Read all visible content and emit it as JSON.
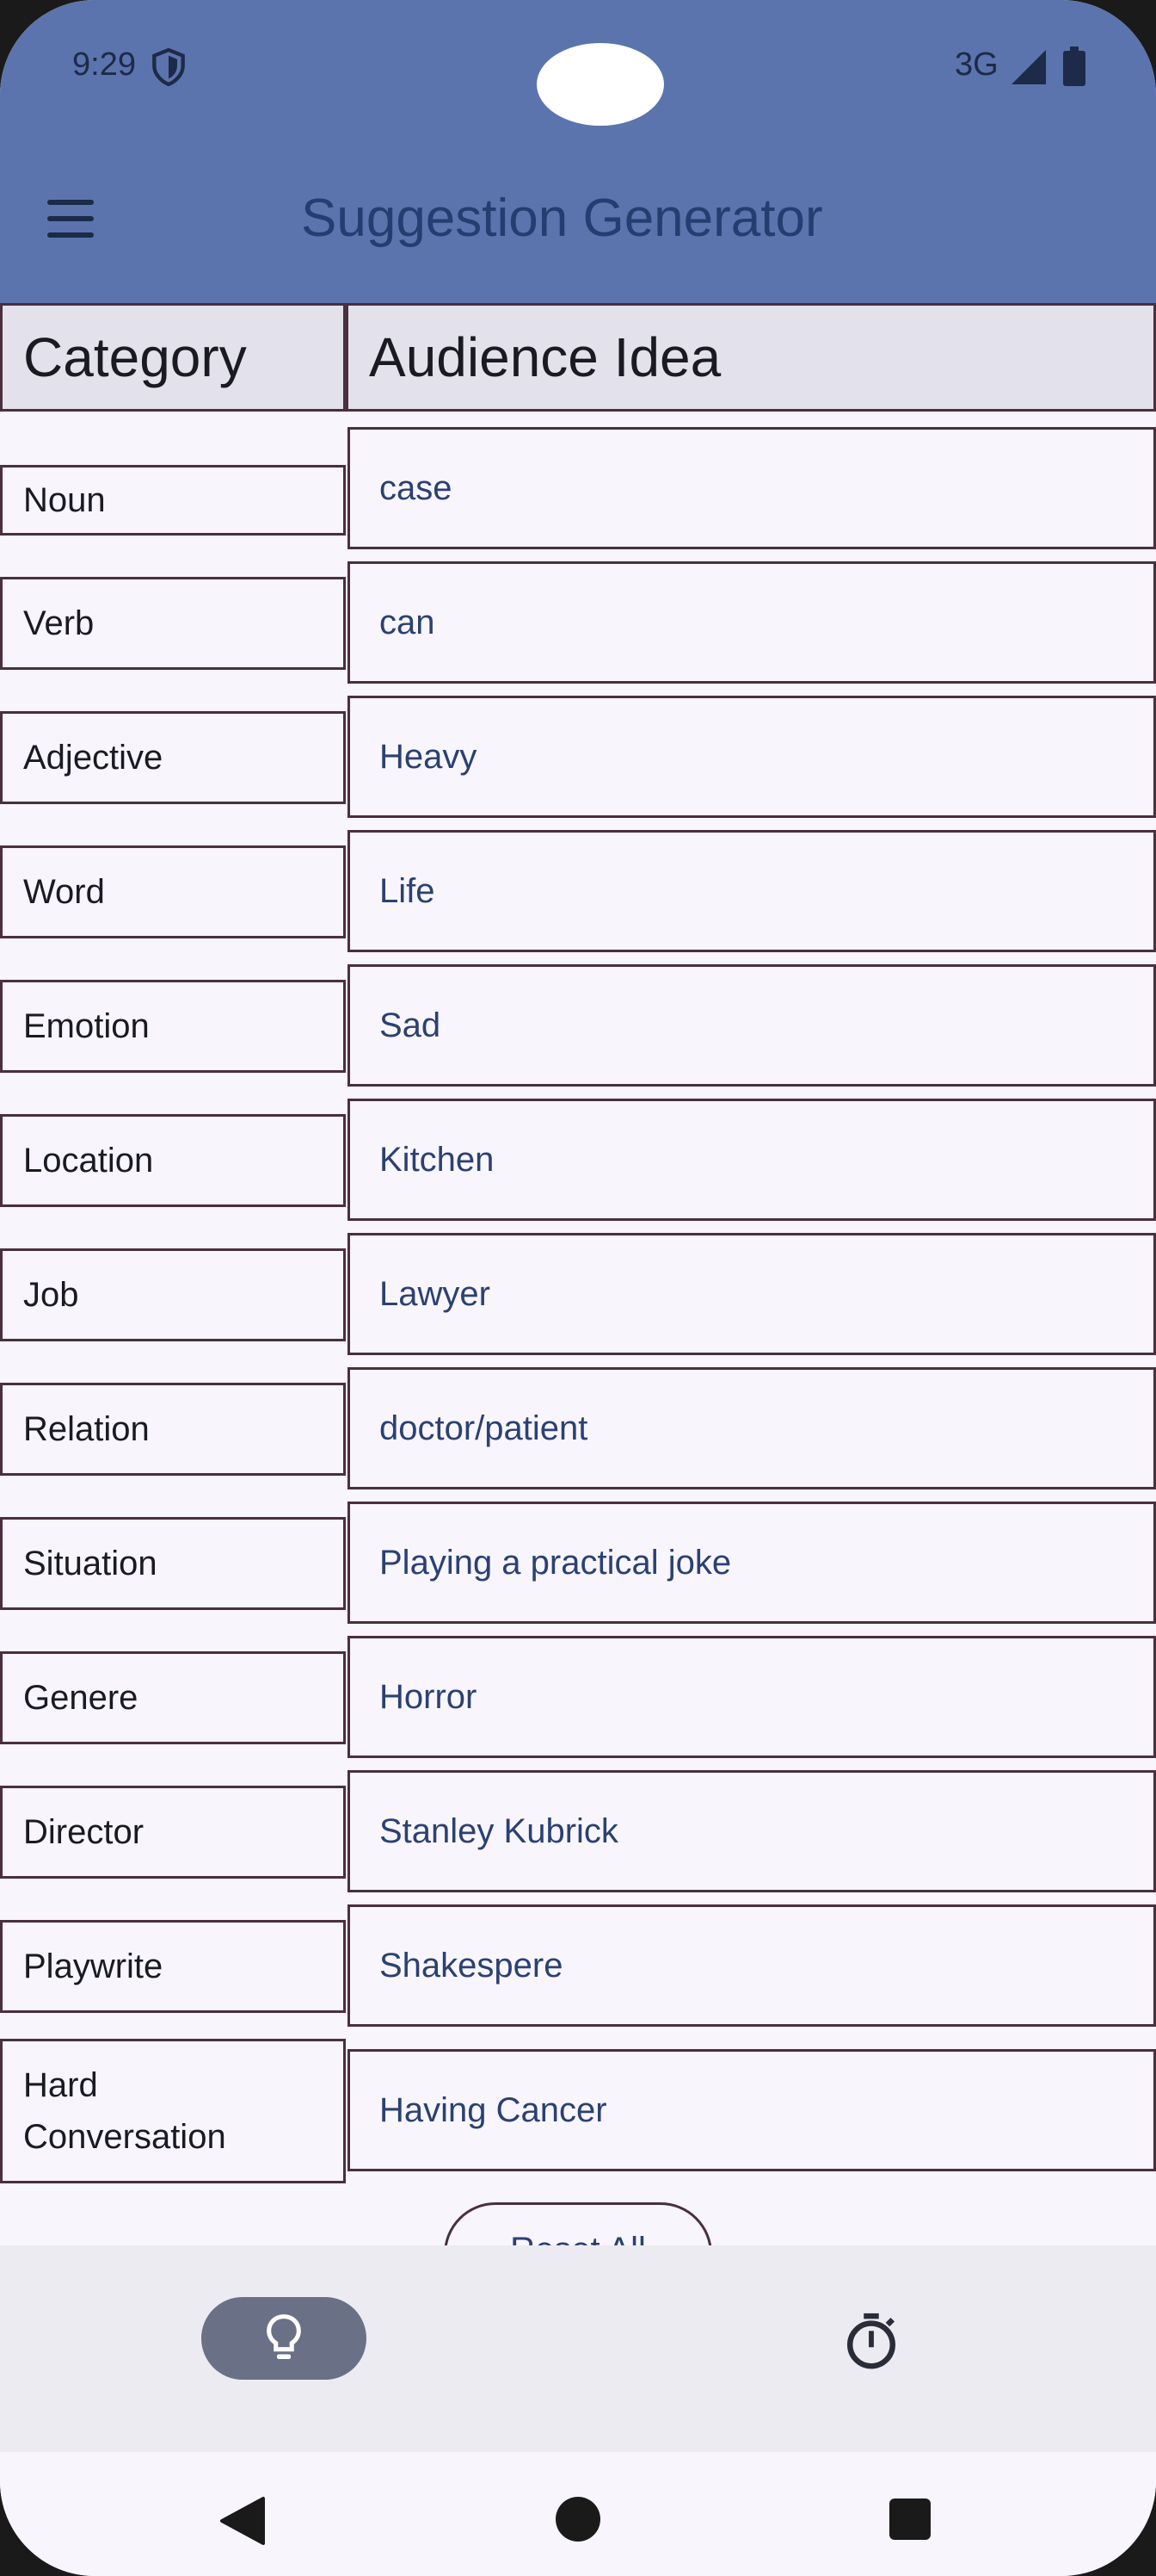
{
  "status_bar": {
    "time": "9:29",
    "network": "3G"
  },
  "app_bar": {
    "title": "Suggestion Generator"
  },
  "table": {
    "header": {
      "category": "Category",
      "idea": "Audience Idea"
    },
    "rows": [
      {
        "category": "Noun",
        "idea": "case"
      },
      {
        "category": "Verb",
        "idea": "can"
      },
      {
        "category": "Adjective",
        "idea": "Heavy"
      },
      {
        "category": "Word",
        "idea": "Life"
      },
      {
        "category": "Emotion",
        "idea": "Sad"
      },
      {
        "category": "Location",
        "idea": "Kitchen"
      },
      {
        "category": "Job",
        "idea": "Lawyer"
      },
      {
        "category": "Relation",
        "idea": "doctor/patient"
      },
      {
        "category": "Situation",
        "idea": "Playing a practical joke"
      },
      {
        "category": "Genere",
        "idea": "Horror"
      },
      {
        "category": "Director",
        "idea": "Stanley Kubrick"
      },
      {
        "category": "Playwrite",
        "idea": "Shakespere"
      },
      {
        "category": "Hard Conversation",
        "idea": "Having Cancer"
      }
    ]
  },
  "reset_button": {
    "label": "Reset All"
  },
  "bottom_nav": {
    "items": [
      {
        "icon": "lightbulb-icon",
        "selected": true
      },
      {
        "icon": "timer-icon",
        "selected": false
      }
    ]
  },
  "colors": {
    "app_bar": "#5c74ad",
    "header_bg": "#e3e2ec",
    "border": "#4a2f3e",
    "idea_text": "#2b4171",
    "nav_selected": "#6a7186"
  }
}
